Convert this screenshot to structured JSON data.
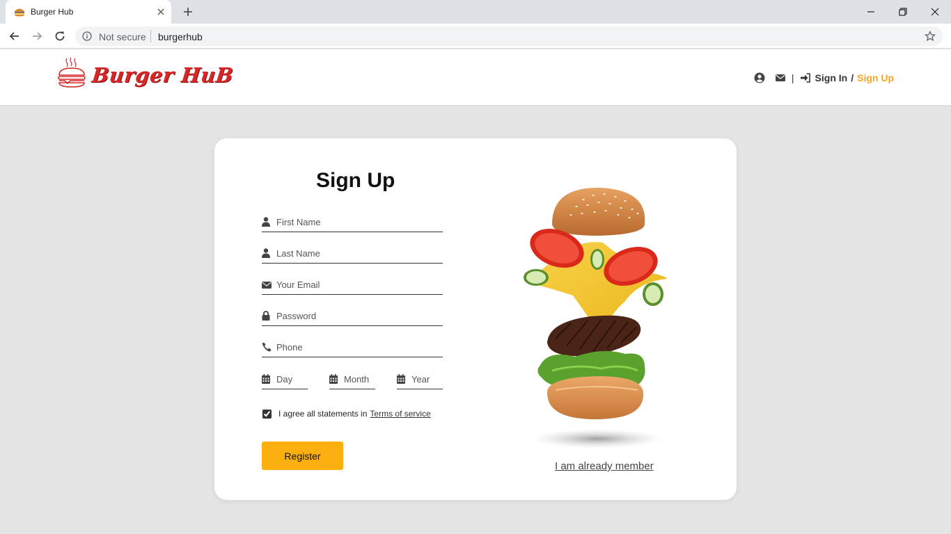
{
  "browser": {
    "tab_title": "Burger Hub",
    "security_label": "Not secure",
    "url": "burgerhub"
  },
  "header": {
    "logo_text": "Burger HuB",
    "signin_label": "Sign In",
    "separator": "/",
    "signup_label": "Sign Up",
    "pipe": "|",
    "accent_color": "#f5a623"
  },
  "form": {
    "title": "Sign Up",
    "first_name_placeholder": "First Name",
    "last_name_placeholder": "Last Name",
    "email_placeholder": "Your Email",
    "password_placeholder": "Password",
    "phone_placeholder": "Phone",
    "day_placeholder": "Day",
    "month_placeholder": "Month",
    "year_placeholder": "Year",
    "agree_text": "I agree all statements in",
    "terms_link": "Terms of service",
    "agree_checked": true,
    "register_label": "Register",
    "member_link": "I am already member",
    "button_color": "#fcb00f"
  },
  "icons": {
    "user": "user-icon",
    "email": "envelope-icon",
    "lock": "lock-icon",
    "phone": "phone-icon",
    "calendar": "calendar-icon",
    "signin": "sign-in-icon"
  }
}
